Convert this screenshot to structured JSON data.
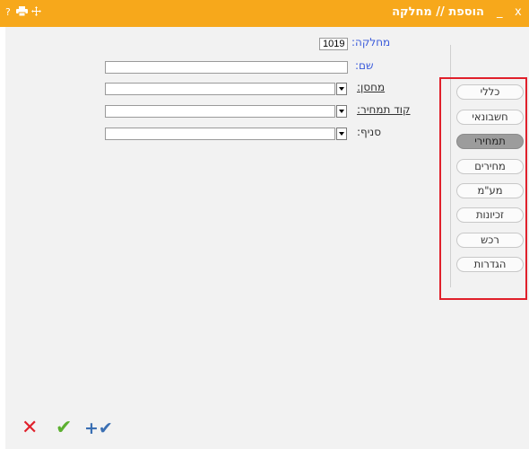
{
  "titlebar": {
    "title": "הוספת // מחלקה",
    "icons": [
      "help-icon",
      "printer-icon",
      "move-icon"
    ],
    "help_text": "?",
    "minimize_text": "_",
    "close_text": "x"
  },
  "form": {
    "department_label": "מחלקה:",
    "department_value": "1019",
    "name_label": "שם:",
    "name_value": "",
    "warehouse_label": "מחסן:",
    "warehouse_value": "",
    "pricing_code_label": "קוד תמחיר:",
    "pricing_code_value": "",
    "branch_label": "סניף:",
    "branch_value": ""
  },
  "tabs": [
    {
      "label": "כללי",
      "active": false
    },
    {
      "label": "חשבונאי",
      "active": false
    },
    {
      "label": "תמחירי",
      "active": true
    },
    {
      "label": "מחירים",
      "active": false
    },
    {
      "label": "מע\"מ",
      "active": false
    },
    {
      "label": "זכיונות",
      "active": false
    },
    {
      "label": "רכש",
      "active": false
    },
    {
      "label": "הגדרות",
      "active": false
    }
  ],
  "actions": {
    "cancel_symbol": "✕",
    "confirm_symbol": "✔",
    "confirm_add_symbol": "+✔"
  },
  "colors": {
    "titlebar": "#f7a81b",
    "highlight_box": "#e0202b",
    "cancel": "#e0202b",
    "confirm": "#5cb030",
    "confirm_add": "#3a6fb3"
  }
}
